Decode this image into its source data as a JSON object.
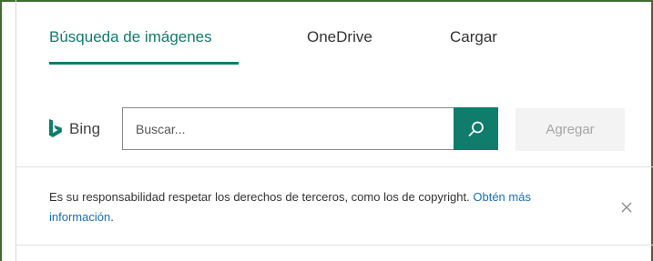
{
  "tabs": [
    {
      "label": "Búsqueda de imágenes",
      "active": true
    },
    {
      "label": "OneDrive",
      "active": false
    },
    {
      "label": "Cargar",
      "active": false
    }
  ],
  "search": {
    "provider_label": "Bing",
    "placeholder": "Buscar...",
    "search_icon": "search-icon",
    "add_label": "Agregar"
  },
  "notice": {
    "text": "Es su responsabilidad respetar los derechos de terceros, como los de copyright.",
    "link": "Obtén más información",
    "link_suffix": ".",
    "close_icon": "close-icon"
  },
  "colors": {
    "accent": "#0f7c6c",
    "link": "#1a6fb5",
    "frame": "#3d6e2e"
  }
}
